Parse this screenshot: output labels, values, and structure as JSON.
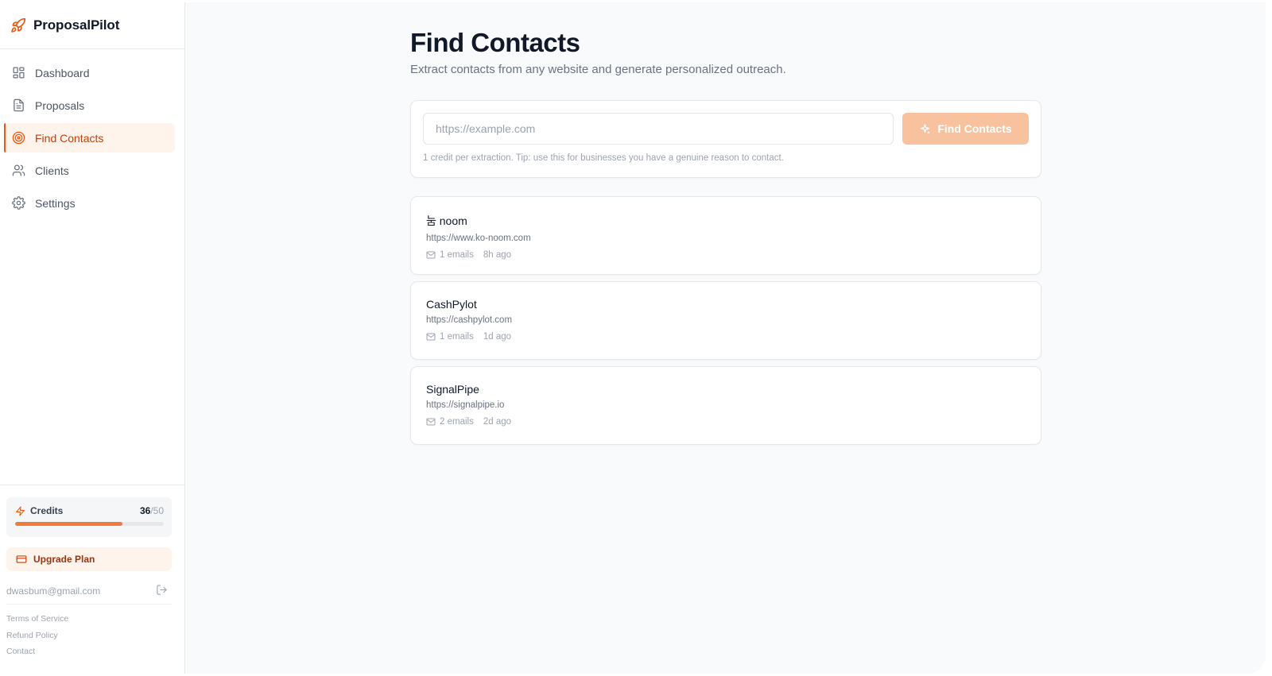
{
  "brand": {
    "name": "ProposalPilot"
  },
  "nav": [
    {
      "label": "Dashboard",
      "icon": "dashboard-icon",
      "active": false
    },
    {
      "label": "Proposals",
      "icon": "document-icon",
      "active": false
    },
    {
      "label": "Find Contacts",
      "icon": "target-icon",
      "active": true
    },
    {
      "label": "Clients",
      "icon": "users-icon",
      "active": false
    },
    {
      "label": "Settings",
      "icon": "gear-icon",
      "active": false
    }
  ],
  "credits": {
    "label": "Credits",
    "used": "36",
    "sep": "/",
    "total": "50",
    "fraction": 0.72
  },
  "upgrade_label": "Upgrade Plan",
  "user": {
    "email": "dwasbum@gmail.com"
  },
  "footer_links": [
    "Terms of Service",
    "Refund Policy",
    "Contact"
  ],
  "page": {
    "title": "Find Contacts",
    "subtitle": "Extract contacts from any website and generate personalized outreach."
  },
  "search": {
    "placeholder": "https://example.com",
    "value": "",
    "button_label": "Find Contacts",
    "tip": "1 credit per extraction. Tip: use this for businesses you have a genuine reason to contact."
  },
  "results": [
    {
      "name": "눔 noom",
      "url": "https://www.ko-noom.com",
      "emails": "1 emails",
      "time": "8h ago"
    },
    {
      "name": "CashPylot",
      "url": "https://cashpylot.com",
      "emails": "1 emails",
      "time": "1d ago"
    },
    {
      "name": "SignalPipe",
      "url": "https://signalpipe.io",
      "emails": "2 emails",
      "time": "2d ago"
    }
  ],
  "colors": {
    "accent": "#ea580c",
    "accent_soft": "#fff4ec",
    "button_disabled": "#f8c29f",
    "progress": "#f07c3c"
  }
}
